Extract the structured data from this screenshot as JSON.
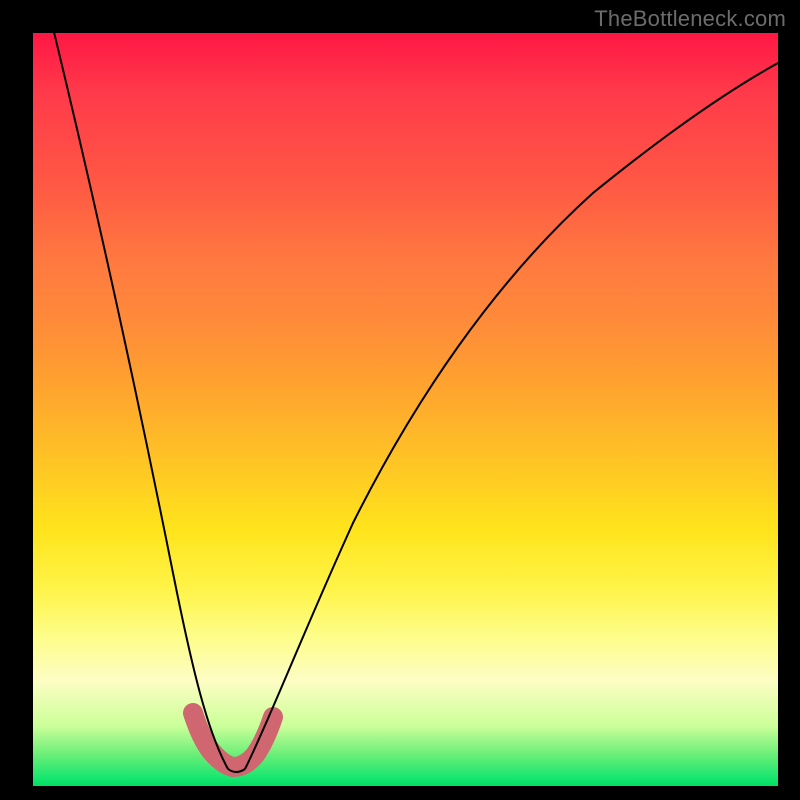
{
  "watermark": "TheBottleneck.com",
  "colors": {
    "background": "#000000",
    "gradient_top": "#ff1744",
    "gradient_mid": "#ffe41c",
    "gradient_bottom": "#00e060",
    "curve": "#000000",
    "lobe": "#cf6670"
  },
  "chart_data": {
    "type": "line",
    "title": "",
    "xlabel": "",
    "ylabel": "",
    "xlim": [
      0,
      100
    ],
    "ylim": [
      0,
      100
    ],
    "x": [
      6,
      8,
      10,
      12,
      14,
      16,
      18,
      20,
      22,
      24,
      26,
      27,
      28,
      30,
      32,
      34,
      38,
      42,
      46,
      50,
      55,
      60,
      65,
      70,
      75,
      80,
      85,
      90,
      95,
      100
    ],
    "values": [
      100,
      92,
      83,
      74,
      65,
      56,
      47,
      38,
      29,
      20,
      11,
      5,
      2,
      2,
      6,
      14,
      26,
      36,
      45,
      52,
      60,
      66,
      72,
      77,
      81,
      85,
      88,
      91,
      93,
      95
    ],
    "lobe_segment": {
      "x": [
        24.5,
        25.5,
        26.5,
        27.5,
        28.5,
        29.5,
        30.5,
        31.5
      ],
      "values": [
        8,
        5,
        3,
        2.2,
        2.2,
        3,
        5,
        8
      ]
    },
    "notes": "Values estimated from pixel positions; minimum of the curve occurs near x≈28, y≈2; left arm originates near top-left, right arm asymptotes toward top-right."
  }
}
